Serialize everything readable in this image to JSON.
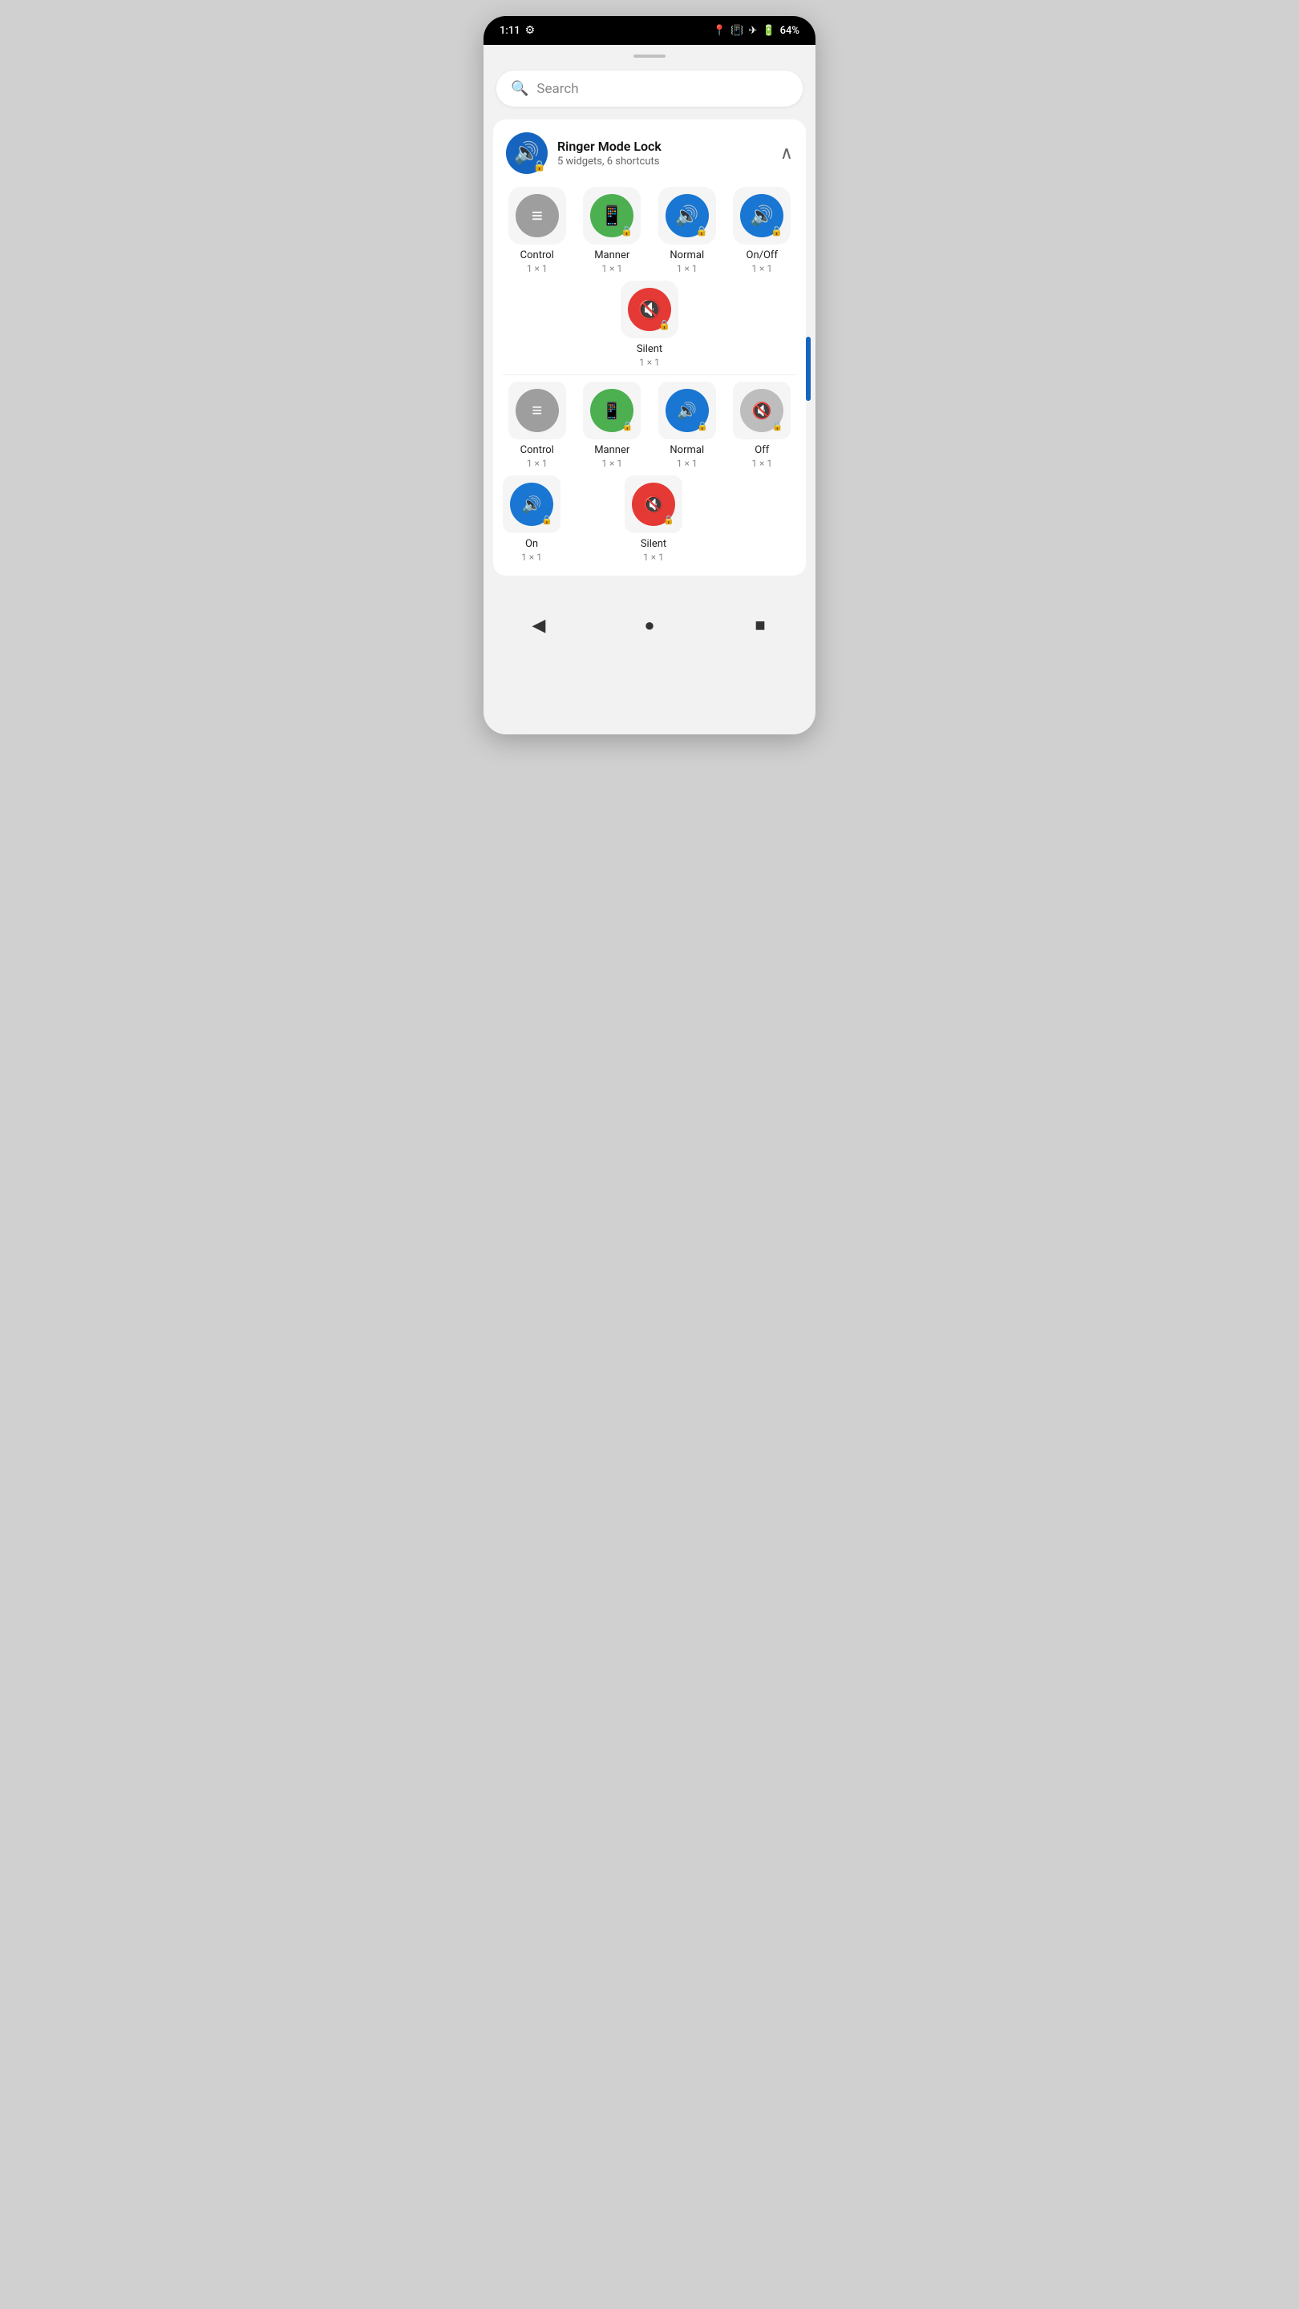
{
  "statusBar": {
    "time": "1:11",
    "battery": "64%",
    "icons": [
      "location",
      "vibrate",
      "airplane",
      "battery"
    ]
  },
  "search": {
    "placeholder": "Search"
  },
  "appSection": {
    "title": "Ringer Mode Lock",
    "subtitle": "5 widgets, 6 shortcuts"
  },
  "widgets": [
    {
      "name": "Control",
      "size": "1 × 1",
      "color": "gray",
      "icon": "⚙",
      "lock": true
    },
    {
      "name": "Manner",
      "size": "1 × 1",
      "color": "green",
      "icon": "📱",
      "lock": true
    },
    {
      "name": "Normal",
      "size": "1 × 1",
      "color": "blue",
      "icon": "🔊",
      "lock": true
    },
    {
      "name": "On/Off",
      "size": "1 × 1",
      "color": "blue",
      "icon": "🔊",
      "lock": true
    },
    {
      "name": "Silent",
      "size": "1 × 1",
      "color": "red",
      "icon": "🔇",
      "lock": true
    }
  ],
  "shortcuts": [
    {
      "name": "Control",
      "size": "1 × 1",
      "color": "gray",
      "icon": "⚙",
      "lock": false
    },
    {
      "name": "Manner",
      "size": "1 × 1",
      "color": "green",
      "icon": "📱",
      "lock": false
    },
    {
      "name": "Normal",
      "size": "1 × 1",
      "color": "blue",
      "icon": "🔊",
      "lock": false
    },
    {
      "name": "Off",
      "size": "1 × 1",
      "color": "gray-light",
      "icon": "🔇",
      "lock": false
    },
    {
      "name": "On",
      "size": "1 × 1",
      "color": "blue",
      "icon": "🔊",
      "lock": false
    },
    {
      "name": "Silent",
      "size": "1 × 1",
      "color": "red",
      "icon": "🔇",
      "lock": false
    }
  ],
  "navBar": {
    "back": "◀",
    "home": "●",
    "recents": "■"
  }
}
